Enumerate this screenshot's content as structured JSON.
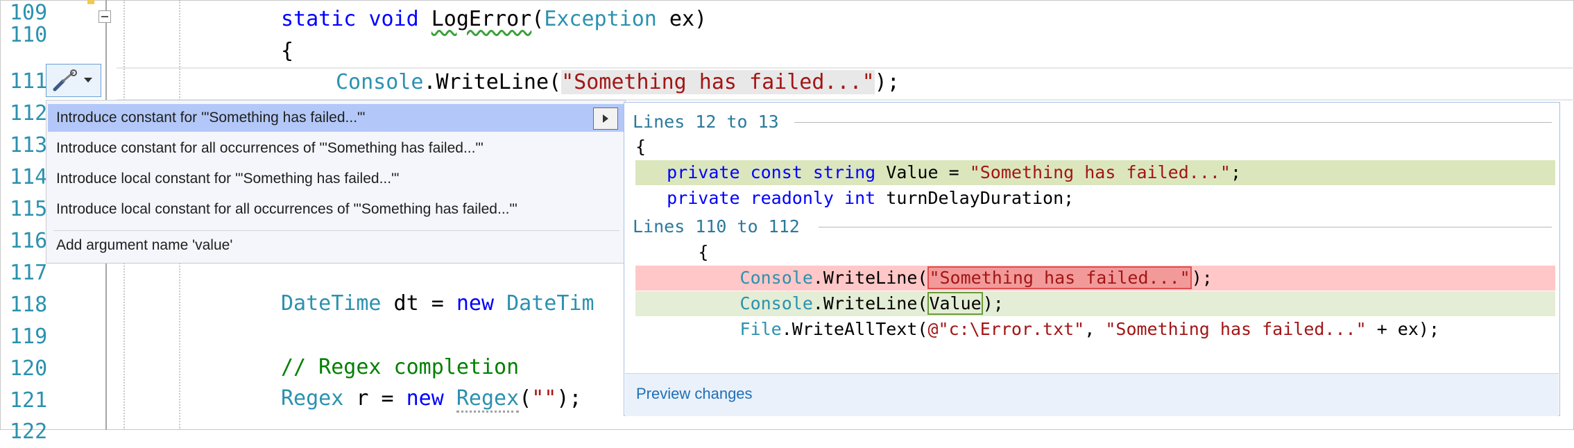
{
  "editor": {
    "line_numbers": [
      "109",
      "110",
      "111",
      "112",
      "113",
      "114",
      "115",
      "116",
      "117",
      "118",
      "119",
      "120",
      "121",
      "122"
    ],
    "code": {
      "l109": {
        "kw1": "static",
        "kw2": "void",
        "name": "LogError",
        "p1": "(",
        "type": "Exception",
        "rest": " ex)"
      },
      "l110": {
        "text": "{"
      },
      "l111": {
        "type": "Console",
        "mid": ".WriteLine(",
        "str": "\"Something has failed...\"",
        "end": ");"
      },
      "l118": {
        "type": "DateTime",
        "mid": " dt = ",
        "kw": "new",
        "type2": "DateTim"
      },
      "l120": {
        "comment": "// Regex completion"
      },
      "l121": {
        "type": "Regex",
        "mid": " r = ",
        "kw": "new",
        "type2": "Regex",
        "p1": "(",
        "str": "\"\"",
        "end": ");"
      }
    }
  },
  "lightbulb": {
    "icon": "screwdriver-icon"
  },
  "quick_actions": {
    "items": [
      {
        "label": "Introduce constant for '\"Something has failed...\"'"
      },
      {
        "label": "Introduce constant for all occurrences of '\"Something has failed...\"'"
      },
      {
        "label": "Introduce local constant for '\"Something has failed...\"'"
      },
      {
        "label": "Introduce local constant for all occurrences of '\"Something has failed...\"'"
      },
      {
        "label": "Add argument name 'value'"
      }
    ]
  },
  "preview": {
    "header1": "Lines 12 to 13",
    "header2": "Lines 110 to 112",
    "l1": {
      "text": "{"
    },
    "l2": {
      "kw1": "private",
      "kw2": "const",
      "kw3": "string",
      "mid": " Value = ",
      "str": "\"Something has failed...\"",
      "end": ";"
    },
    "l3": {
      "kw1": "private",
      "kw2": "readonly",
      "kw3": "int",
      "rest": " turnDelayDuration;"
    },
    "l4": {
      "text": "{"
    },
    "l5": {
      "type": "Console",
      "mid": ".WriteLine(",
      "str": "\"Something has failed...\"",
      "end": ");"
    },
    "l6": {
      "type": "Console",
      "mid": ".WriteLine(",
      "val": "Value",
      "end": ");"
    },
    "l7": {
      "type": "File",
      "mid": ".WriteAllText(",
      "at": "@",
      "str1": "\"c:\\Error.txt\"",
      "comma": ", ",
      "str2": "\"Something has failed...\"",
      "end": " + ex);"
    },
    "link": "Preview changes"
  },
  "colors": {
    "keyword": "#0000ff",
    "type": "#2b91af",
    "string": "#a31515",
    "comment": "#008000",
    "selection": "#b3c8f8"
  }
}
